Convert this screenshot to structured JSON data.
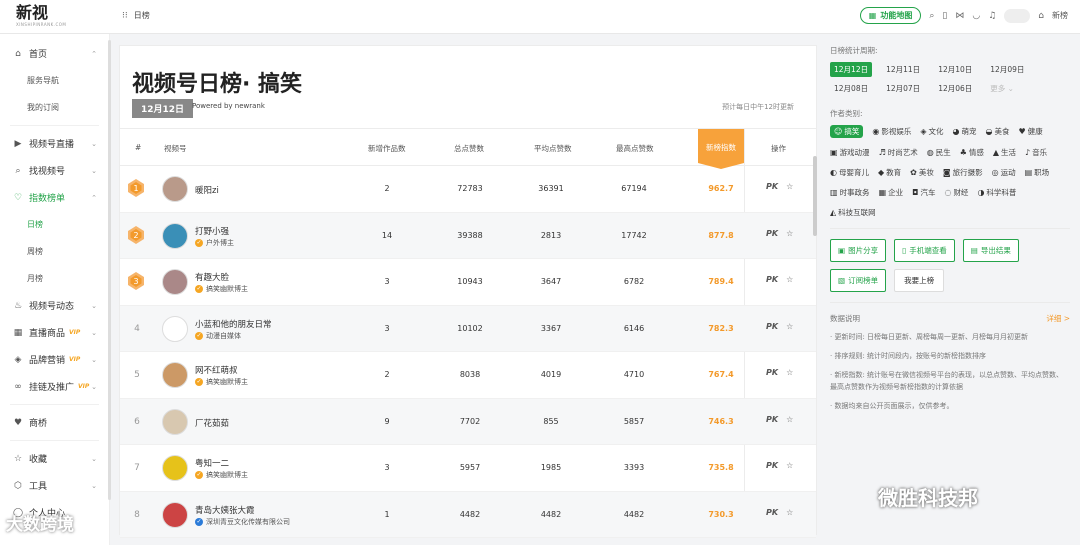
{
  "app": {
    "logo": "新视",
    "logo_sub": "XINSHIPINRANK.COM",
    "breadcrumb": "日榜"
  },
  "topbar": {
    "map_label": "功能地图",
    "user_label": "新榜"
  },
  "sidebar": {
    "items": [
      {
        "label": "首页",
        "icon": "home-icon",
        "chev": "⌃",
        "sub": [
          "服务导航",
          "我的订阅"
        ]
      },
      {
        "label": "视频号直播",
        "icon": "live-icon",
        "chev": "⌄"
      },
      {
        "label": "找视频号",
        "icon": "search-icon",
        "chev": "⌄"
      },
      {
        "label": "指数榜单",
        "icon": "heart-icon",
        "chev": "⌃",
        "active": true,
        "sub": [
          "日榜",
          "周榜",
          "月榜"
        ]
      },
      {
        "label": "视频号动态",
        "icon": "fire-icon",
        "chev": "⌄"
      },
      {
        "label": "直播商品",
        "icon": "store-icon",
        "chev": "⌄",
        "vip": "VIP"
      },
      {
        "label": "品牌营销",
        "icon": "brand-icon",
        "chev": "⌄",
        "vip": "VIP"
      },
      {
        "label": "挂链及推广",
        "icon": "link-icon",
        "chev": "⌄",
        "vip": "VIP"
      },
      {
        "label": "商桥",
        "icon": "bridge-icon"
      },
      {
        "label": "收藏",
        "icon": "star-icon",
        "chev": "⌄"
      },
      {
        "label": "工具",
        "icon": "tool-icon",
        "chev": "⌄"
      },
      {
        "label": "个人中心",
        "icon": "user-icon"
      }
    ]
  },
  "main": {
    "title": "视频号日榜· 搞笑",
    "date_badge": "12月12日",
    "powered": "Powered by newrank",
    "estimate": "预计每日中午12时更新",
    "headers": {
      "rank": "#",
      "account": "视频号",
      "new_works": "新增作品数",
      "total_likes": "总点赞数",
      "avg_likes": "平均点赞数",
      "max_likes": "最高点赞数",
      "index": "新榜指数",
      "ops": "操作"
    },
    "ops": {
      "pk": "PK",
      "fav": "☆"
    },
    "rows": [
      {
        "rank": "1",
        "name": "暖阳zi",
        "tag": "",
        "works": "2",
        "total": "72783",
        "avg": "36391",
        "max": "67194",
        "index": "962.7",
        "avcolor": "#b99a8a",
        "tagcolor": ""
      },
      {
        "rank": "2",
        "name": "打野小强",
        "tag": "户外博主",
        "works": "14",
        "total": "39388",
        "avg": "2813",
        "max": "17742",
        "index": "877.8",
        "avcolor": "#3a8fb7",
        "tagcolor": "#f5a623"
      },
      {
        "rank": "3",
        "name": "有趣大脸",
        "tag": "搞笑幽默博主",
        "works": "3",
        "total": "10943",
        "avg": "3647",
        "max": "6782",
        "index": "789.4",
        "avcolor": "#a88",
        "tagcolor": "#f5a623"
      },
      {
        "rank": "4",
        "name": "小蓝和他的朋友日常",
        "tag": "动漫自媒体",
        "works": "3",
        "total": "10102",
        "avg": "3367",
        "max": "6146",
        "index": "782.3",
        "avcolor": "#ffffff",
        "tagcolor": "#f5a623"
      },
      {
        "rank": "5",
        "name": "网不红萌叔",
        "tag": "搞笑幽默博主",
        "works": "2",
        "total": "8038",
        "avg": "4019",
        "max": "4710",
        "index": "767.4",
        "avcolor": "#c96",
        "tagcolor": "#f5a623"
      },
      {
        "rank": "6",
        "name": "厂花茹茹",
        "tag": "",
        "works": "9",
        "total": "7702",
        "avg": "855",
        "max": "5857",
        "index": "746.3",
        "avcolor": "#d8c8b0",
        "tagcolor": ""
      },
      {
        "rank": "7",
        "name": "粤知一二",
        "tag": "搞笑幽默博主",
        "works": "3",
        "total": "5957",
        "avg": "1985",
        "max": "3393",
        "index": "735.8",
        "avcolor": "#e6c21a",
        "tagcolor": "#f5a623"
      },
      {
        "rank": "8",
        "name": "青岛大姨张大霞",
        "tag": "深圳青豆文化传媒有限公司",
        "works": "1",
        "total": "4482",
        "avg": "4482",
        "max": "4482",
        "index": "730.3",
        "avcolor": "#c44",
        "tagcolor": "#2b7bd8"
      }
    ]
  },
  "right": {
    "period_label": "日榜统计周期:",
    "dates": [
      "12月12日",
      "12月11日",
      "12月10日",
      "12月09日",
      "12月08日",
      "12月07日",
      "12月06日",
      "更多 ⌄"
    ],
    "cat_label": "作者类别:",
    "cats": [
      {
        "l": "搞笑",
        "i": "☺"
      },
      {
        "l": "影视娱乐",
        "i": "◉"
      },
      {
        "l": "文化",
        "i": "◈"
      },
      {
        "l": "萌宠",
        "i": "◕"
      },
      {
        "l": "美食",
        "i": "◒"
      },
      {
        "l": "健康",
        "i": "♥"
      },
      {
        "l": "游戏动漫",
        "i": "▣"
      },
      {
        "l": "时尚艺术",
        "i": "♬"
      },
      {
        "l": "民生",
        "i": "◍"
      },
      {
        "l": "情感",
        "i": "♣"
      },
      {
        "l": "生活",
        "i": "▲"
      },
      {
        "l": "音乐",
        "i": "♪"
      },
      {
        "l": "母婴育儿",
        "i": "◐"
      },
      {
        "l": "教育",
        "i": "◆"
      },
      {
        "l": "美妆",
        "i": "✿"
      },
      {
        "l": "旅行摄影",
        "i": "◙"
      },
      {
        "l": "运动",
        "i": "◎"
      },
      {
        "l": "职场",
        "i": "▤"
      },
      {
        "l": "时事政务",
        "i": "▥"
      },
      {
        "l": "企业",
        "i": "▦"
      },
      {
        "l": "汽车",
        "i": "◘"
      },
      {
        "l": "财经",
        "i": "◌"
      },
      {
        "l": "科学科普",
        "i": "◑"
      },
      {
        "l": "科技互联网",
        "i": "◭"
      }
    ],
    "buttons": {
      "share": "图片分享",
      "mobile": "手机端查看",
      "export": "导出结果",
      "subscribe": "订阅榜单",
      "join": "我要上榜"
    },
    "expl_label": "数据说明",
    "expl_more": "详细 >",
    "expl": [
      "· 更新时间: 日榜每日更新、周榜每周一更新、月榜每月月初更新",
      "· 排序规则: 统计时间段内，按账号的新榜指数排序",
      "· 新榜指数: 统计账号在微信视频号平台的表现，以总点赞数、平均点赞数、最高点赞数作为视频号新榜指数的计算依据",
      "· 数据均来自公开页面展示，仅供参考。"
    ]
  },
  "watermarks": {
    "left": "大数跨境",
    "right": "微胜科技邦"
  }
}
